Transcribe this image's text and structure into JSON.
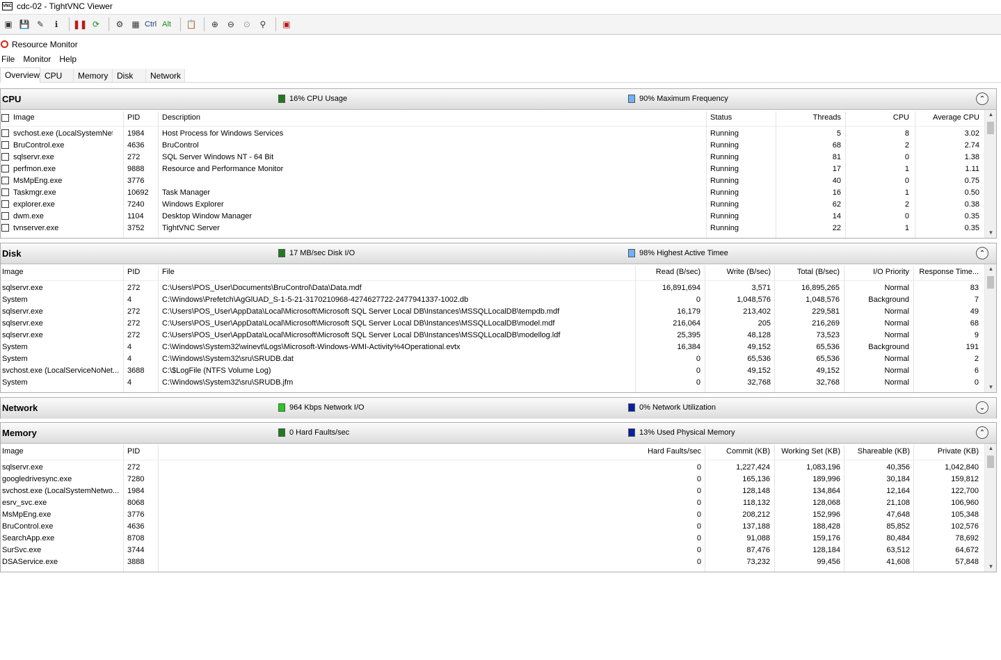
{
  "vnc": {
    "title": "cdc-02 - TightVNC Viewer",
    "logo_text": "VNC",
    "toolbar": {
      "ctrl_label": "Ctrl",
      "alt_label": "Alt",
      "icons": [
        "new-connection-icon",
        "save-icon",
        "options-icon",
        "info-icon",
        "pause-icon",
        "refresh-icon",
        "ctrl-alt-del-icon",
        "ctrl-esc-icon",
        "ctrl-key-icon",
        "alt-key-icon",
        "clipboard-icon",
        "zoom-in-icon",
        "zoom-out-icon",
        "zoom-100-icon",
        "zoom-auto-icon",
        "fullscreen-icon"
      ]
    }
  },
  "app": {
    "title": "Resource Monitor",
    "menu": [
      "File",
      "Monitor",
      "Help"
    ],
    "tabs": [
      "Overview",
      "CPU",
      "Memory",
      "Disk",
      "Network"
    ],
    "active_tab": "Overview"
  },
  "cpu": {
    "title": "CPU",
    "stat1": "16% CPU Usage",
    "stat1_color": "#1e7b1e",
    "stat2": "90% Maximum Frequency",
    "stat2_color": "#6fb0ff",
    "headers": [
      "Image",
      "PID",
      "Description",
      "Status",
      "Threads",
      "CPU",
      "Average CPU"
    ],
    "rows": [
      [
        "svchost.exe (LocalSystemNet...",
        "1984",
        "Host Process for Windows Services",
        "Running",
        "5",
        "8",
        "3.02"
      ],
      [
        "BruControl.exe",
        "4636",
        "BruControl",
        "Running",
        "68",
        "2",
        "2.74"
      ],
      [
        "sqlservr.exe",
        "272",
        "SQL Server Windows NT - 64 Bit",
        "Running",
        "81",
        "0",
        "1.38"
      ],
      [
        "perfmon.exe",
        "9888",
        "Resource and Performance Monitor",
        "Running",
        "17",
        "1",
        "1.11"
      ],
      [
        "MsMpEng.exe",
        "3776",
        "",
        "Running",
        "40",
        "0",
        "0.75"
      ],
      [
        "Taskmgr.exe",
        "10692",
        "Task Manager",
        "Running",
        "16",
        "1",
        "0.50"
      ],
      [
        "explorer.exe",
        "7240",
        "Windows Explorer",
        "Running",
        "62",
        "2",
        "0.38"
      ],
      [
        "dwm.exe",
        "1104",
        "Desktop Window Manager",
        "Running",
        "14",
        "0",
        "0.35"
      ],
      [
        "tvnserver.exe",
        "3752",
        "TightVNC Server",
        "Running",
        "22",
        "1",
        "0.35"
      ]
    ]
  },
  "disk": {
    "title": "Disk",
    "stat1": "17 MB/sec Disk I/O",
    "stat1_color": "#1e7b1e",
    "stat2": "98% Highest Active Timee",
    "stat2_color": "#6fb0ff",
    "headers": [
      "Image",
      "PID",
      "File",
      "Read (B/sec)",
      "Write (B/sec)",
      "Total (B/sec)",
      "I/O Priority",
      "Response Time..."
    ],
    "rows": [
      [
        "sqlservr.exe",
        "272",
        "C:\\Users\\POS_User\\Documents\\BruControl\\Data\\Data.mdf",
        "16,891,694",
        "3,571",
        "16,895,265",
        "Normal",
        "83"
      ],
      [
        "System",
        "4",
        "C:\\Windows\\Prefetch\\AgGlUAD_S-1-5-21-3170210968-4274627722-2477941337-1002.db",
        "0",
        "1,048,576",
        "1,048,576",
        "Background",
        "7"
      ],
      [
        "sqlservr.exe",
        "272",
        "C:\\Users\\POS_User\\AppData\\Local\\Microsoft\\Microsoft SQL Server Local DB\\Instances\\MSSQLLocalDB\\tempdb.mdf",
        "16,179",
        "213,402",
        "229,581",
        "Normal",
        "49"
      ],
      [
        "sqlservr.exe",
        "272",
        "C:\\Users\\POS_User\\AppData\\Local\\Microsoft\\Microsoft SQL Server Local DB\\Instances\\MSSQLLocalDB\\model.mdf",
        "216,064",
        "205",
        "216,269",
        "Normal",
        "68"
      ],
      [
        "sqlservr.exe",
        "272",
        "C:\\Users\\POS_User\\AppData\\Local\\Microsoft\\Microsoft SQL Server Local DB\\Instances\\MSSQLLocalDB\\modellog.ldf",
        "25,395",
        "48,128",
        "73,523",
        "Normal",
        "9"
      ],
      [
        "System",
        "4",
        "C:\\Windows\\System32\\winevt\\Logs\\Microsoft-Windows-WMI-Activity%4Operational.evtx",
        "16,384",
        "49,152",
        "65,536",
        "Background",
        "191"
      ],
      [
        "System",
        "4",
        "C:\\Windows\\System32\\sru\\SRUDB.dat",
        "0",
        "65,536",
        "65,536",
        "Normal",
        "2"
      ],
      [
        "svchost.exe (LocalServiceNoNet...",
        "3688",
        "C:\\$LogFile (NTFS Volume Log)",
        "0",
        "49,152",
        "49,152",
        "Normal",
        "6"
      ],
      [
        "System",
        "4",
        "C:\\Windows\\System32\\sru\\SRUDB.jfm",
        "0",
        "32,768",
        "32,768",
        "Normal",
        "0"
      ]
    ]
  },
  "network": {
    "title": "Network",
    "stat1": "964 Kbps Network I/O",
    "stat1_color": "#22cc22",
    "stat2": "0% Network Utilization",
    "stat2_color": "#0a1fa8"
  },
  "memory": {
    "title": "Memory",
    "stat1": "0 Hard Faults/sec",
    "stat1_color": "#1e7b1e",
    "stat2": "13% Used Physical Memory",
    "stat2_color": "#0a1fa8",
    "headers": [
      "Image",
      "PID",
      "Hard Faults/sec",
      "Commit (KB)",
      "Working Set (KB)",
      "Shareable (KB)",
      "Private (KB)"
    ],
    "rows": [
      [
        "sqlservr.exe",
        "272",
        "0",
        "1,227,424",
        "1,083,196",
        "40,356",
        "1,042,840"
      ],
      [
        "googledrivesync.exe",
        "7280",
        "0",
        "165,136",
        "189,996",
        "30,184",
        "159,812"
      ],
      [
        "svchost.exe (LocalSystemNetwo...",
        "1984",
        "0",
        "128,148",
        "134,864",
        "12,164",
        "122,700"
      ],
      [
        "esrv_svc.exe",
        "8068",
        "0",
        "118,132",
        "128,068",
        "21,108",
        "106,960"
      ],
      [
        "MsMpEng.exe",
        "3776",
        "0",
        "208,212",
        "152,996",
        "47,648",
        "105,348"
      ],
      [
        "BruControl.exe",
        "4636",
        "0",
        "137,188",
        "188,428",
        "85,852",
        "102,576"
      ],
      [
        "SearchApp.exe",
        "8708",
        "0",
        "91,088",
        "159,176",
        "80,484",
        "78,692"
      ],
      [
        "SurSvc.exe",
        "3744",
        "0",
        "87,476",
        "128,184",
        "63,512",
        "64,672"
      ],
      [
        "DSAService.exe",
        "3888",
        "0",
        "73,232",
        "99,456",
        "41,608",
        "57,848"
      ]
    ]
  }
}
